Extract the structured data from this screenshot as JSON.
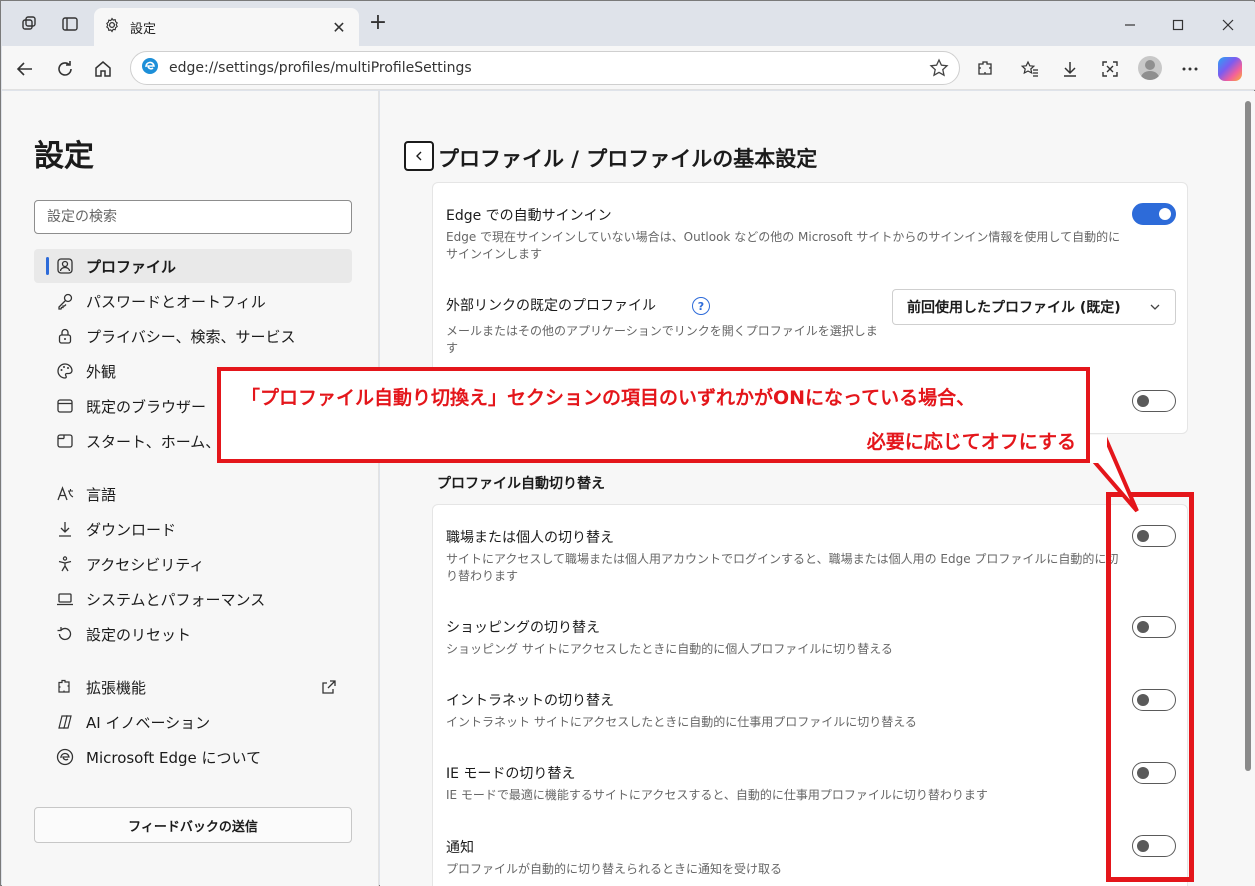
{
  "browser": {
    "tab_title": "設定",
    "url": "edge://settings/profiles/multiProfileSettings"
  },
  "sidebar": {
    "title": "設定",
    "search_placeholder": "設定の検索",
    "items": [
      {
        "label": "プロファイル",
        "icon": "profile-icon",
        "active": true
      },
      {
        "label": "パスワードとオートフィル",
        "icon": "key-icon"
      },
      {
        "label": "プライバシー、検索、サービス",
        "icon": "lock-icon"
      },
      {
        "label": "外観",
        "icon": "palette-icon"
      },
      {
        "label": "既定のブラウザー",
        "icon": "browser-window-icon"
      },
      {
        "label": "スタート、ホーム、",
        "icon": "home-window-icon"
      },
      {
        "label": "言語",
        "icon": "language-icon"
      },
      {
        "label": "ダウンロード",
        "icon": "download-icon"
      },
      {
        "label": "アクセシビリティ",
        "icon": "accessibility-icon"
      },
      {
        "label": "システムとパフォーマンス",
        "icon": "laptop-icon"
      },
      {
        "label": "設定のリセット",
        "icon": "reset-icon"
      },
      {
        "label": "拡張機能",
        "icon": "puzzle-icon"
      },
      {
        "label": "AI イノベーション",
        "icon": "ai-icon"
      },
      {
        "label": "Microsoft Edge について",
        "icon": "edge-logo-icon"
      }
    ],
    "feedback_label": "フィードバックの送信"
  },
  "content": {
    "heading": "プロファイル / プロファイルの基本設定",
    "card1": {
      "auto_signin_title": "Edge での自動サインイン",
      "auto_signin_desc": "Edge で現在サインインしていない場合は、Outlook などの他の Microsoft サイトからのサインイン情報を使用して自動的にサインインします",
      "auto_signin_on": true,
      "external_link_title": "外部リンクの既定のプロファイル",
      "external_link_desc": "メールまたはその他のアプリケーションでリンクを開くプロファイルを選択します",
      "external_link_value": "前回使用したプロファイル (既定)",
      "third_row_on": false
    },
    "section_title": "プロファイル自動切り替え",
    "switch_rows": [
      {
        "title": "職場または個人の切り替え",
        "desc": "サイトにアクセスして職場または個人用アカウントでログインすると、職場または個人用の Edge プロファイルに自動的に切り替わります",
        "on": false
      },
      {
        "title": "ショッピングの切り替え",
        "desc": "ショッピング サイトにアクセスしたときに自動的に個人プロファイルに切り替える",
        "on": false
      },
      {
        "title": "イントラネットの切り替え",
        "desc": "イントラネット サイトにアクセスしたときに自動的に仕事用プロファイルに切り替える",
        "on": false
      },
      {
        "title": "IE モードの切り替え",
        "desc": "IE モードで最適に機能するサイトにアクセスすると、自動的に仕事用プロファイルに切り替わります",
        "on": false
      },
      {
        "title": "通知",
        "desc": "プロファイルが自動的に切り替えられるときに通知を受け取る",
        "on": false
      }
    ]
  },
  "annotation": {
    "line1": "「プロファイル自動り切換え」セクションの項目のいずれかがONになっている場合、",
    "line2": "必要に応じてオフにする",
    "color": "#e4161b"
  }
}
